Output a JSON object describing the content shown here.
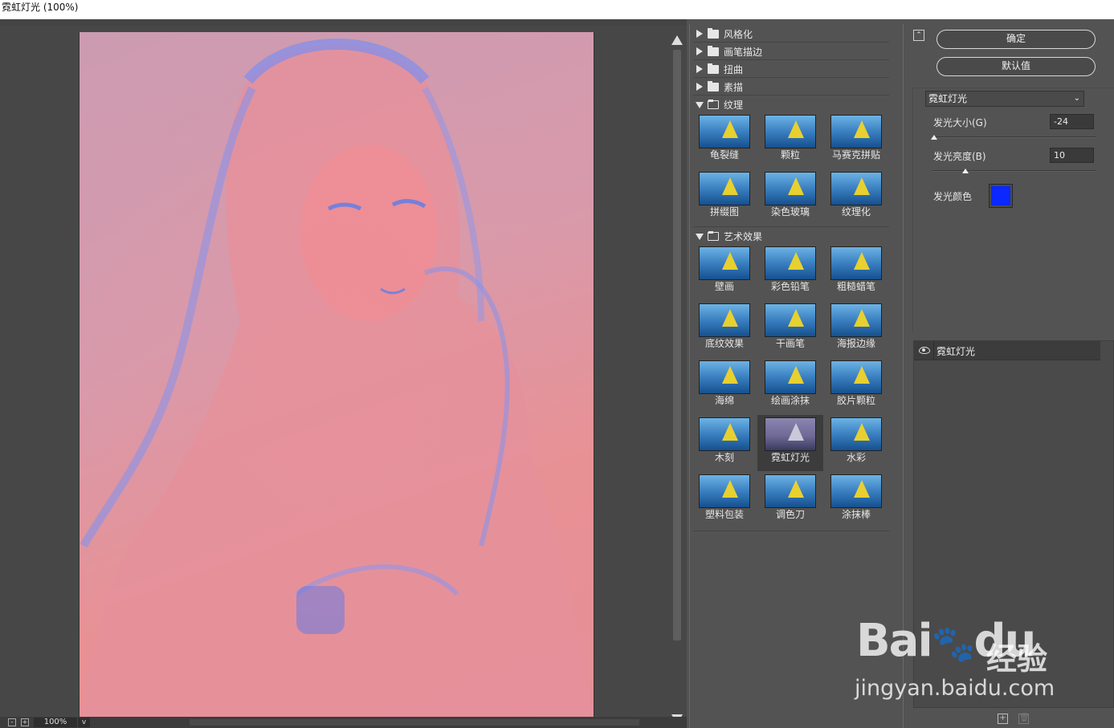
{
  "window": {
    "title": "霓虹灯光 (100%)"
  },
  "statusbar": {
    "zoom_minus": "-",
    "zoom_plus": "+",
    "zoom": "100%",
    "zoom_dropdown": "v"
  },
  "gallery": {
    "categories": [
      {
        "label": "风格化",
        "expanded": false
      },
      {
        "label": "画笔描边",
        "expanded": false
      },
      {
        "label": "扭曲",
        "expanded": false
      },
      {
        "label": "素描",
        "expanded": false
      },
      {
        "label": "纹理",
        "expanded": true
      },
      {
        "label": "艺术效果",
        "expanded": true
      }
    ],
    "texture_filters": [
      "龟裂缝",
      "颗粒",
      "马赛克拼贴",
      "拼缀图",
      "染色玻璃",
      "纹理化"
    ],
    "artistic_filters": [
      "壁画",
      "彩色铅笔",
      "粗糙蜡笔",
      "底纹效果",
      "干画笔",
      "海报边缘",
      "海绵",
      "绘画涂抹",
      "胶片颗粒",
      "木刻",
      "霓虹灯光",
      "水彩",
      "塑料包装",
      "调色刀",
      "涂抹棒"
    ],
    "selected_filter": "霓虹灯光"
  },
  "buttons": {
    "collapse": "⌃",
    "ok": "确定",
    "default": "默认值"
  },
  "settings": {
    "filter_select": "霓虹灯光",
    "glow_size_label": "发光大小(G)",
    "glow_size_value": "-24",
    "glow_size_fraction": 0.01,
    "glow_brightness_label": "发光亮度(B)",
    "glow_brightness_value": "10",
    "glow_brightness_fraction": 0.2,
    "glow_color_label": "发光颜色",
    "glow_color": "#0a28ff"
  },
  "layers": [
    {
      "name": "霓虹灯光",
      "visible": true
    }
  ],
  "layer_actions": {
    "new_layer": "+",
    "delete_layer": "🗑"
  },
  "watermark": {
    "brand": "Bai",
    "brand2": "du",
    "brand_cn": "经验",
    "url": "jingyan.baidu.com"
  }
}
